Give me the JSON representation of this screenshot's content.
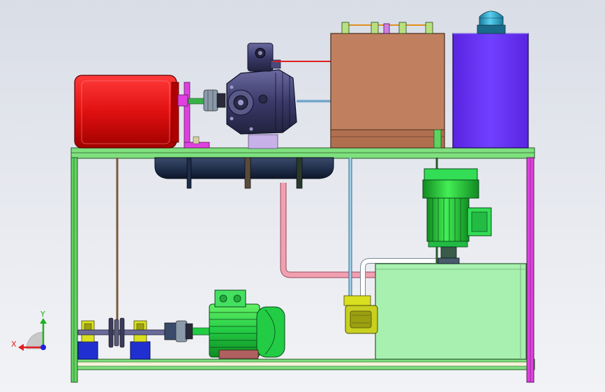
{
  "viewport": {
    "background_top": "#d9dde6",
    "background_bottom": "#f2f3f6"
  },
  "triad": {
    "x_label": "X",
    "y_label": "Y",
    "x_color": "#e02020",
    "y_color": "#20b020",
    "z_color": "#2020e0"
  },
  "colors": {
    "frame_green": "#5fd35f",
    "frame_magenta": "#e040e0",
    "frame_outline": "#2a5a2a",
    "red_tank": "#e01010",
    "blue_cabinet": "#6a2ef0",
    "control_box": "#c08060",
    "oil_tank": "#a8f0b0",
    "motor_green": "#22cc44",
    "pump_body": "#3a3a6a",
    "receiver": "#2a3a5a",
    "pink_pipe": "#f0a0b0",
    "blue_pipe": "#9fd0e8",
    "beacon": "#2aa0c0",
    "base_block": "#2030d0",
    "bracket_yellow": "#d8e020",
    "belt": "#7a5a3a"
  },
  "components": [
    {
      "id": "red-reservoir",
      "icon": "tank-icon"
    },
    {
      "id": "hydraulic-pump",
      "icon": "pump-icon"
    },
    {
      "id": "control-box",
      "icon": "box-icon"
    },
    {
      "id": "electrical-cabinet",
      "icon": "cabinet-icon"
    },
    {
      "id": "warning-beacon",
      "icon": "beacon-icon"
    },
    {
      "id": "air-receiver",
      "icon": "cylinder-icon"
    },
    {
      "id": "vertical-motor",
      "icon": "motor-icon"
    },
    {
      "id": "oil-tank",
      "icon": "tank-icon"
    },
    {
      "id": "gear-pump",
      "icon": "pump-icon"
    },
    {
      "id": "horizontal-motor",
      "icon": "motor-icon"
    },
    {
      "id": "pulley-assembly",
      "icon": "pulley-icon"
    }
  ]
}
